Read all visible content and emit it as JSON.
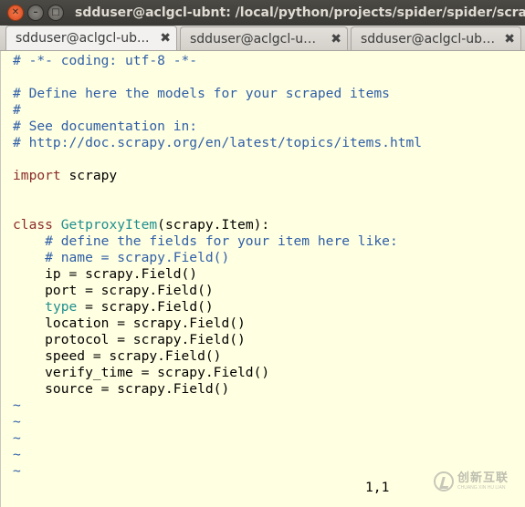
{
  "window": {
    "title": "sdduser@aclgcl-ubnt: /local/python/projects/spider/spider/scrap"
  },
  "tabs": [
    {
      "label": "sdduser@aclgcl-ub..."
    },
    {
      "label": "sdduser@aclgcl-ubn..."
    },
    {
      "label": "sdduser@aclgcl-ubn..."
    }
  ],
  "editor": {
    "l1": "# -*- coding: utf-8 -*-",
    "l3": "# Define here the models for your scraped items",
    "l4": "#",
    "l5": "# See documentation in:",
    "l6": "# http://doc.scrapy.org/en/latest/topics/items.html",
    "l8_kw": "import",
    "l8_rest": " scrapy",
    "l11_kw": "class",
    "l11_cls": " GetproxyItem",
    "l11_rest": "(scrapy.Item):",
    "l12": "    # define the fields for your item here like:",
    "l13": "    # name = scrapy.Field()",
    "l14": "    ip = scrapy.Field()",
    "l15": "    port = scrapy.Field()",
    "l16_indent": "    ",
    "l16_bi": "type",
    "l16_rest": " = scrapy.Field()",
    "l17": "    location = scrapy.Field()",
    "l18": "    protocol = scrapy.Field()",
    "l19": "    speed = scrapy.Field()",
    "l20": "    verify_time = scrapy.Field()",
    "l21": "    source = scrapy.Field()",
    "tilde": "~",
    "cursor_pos": "1,1"
  },
  "watermark": {
    "main": "创新互联",
    "sub": "CHUANG XIN HU LIAN"
  }
}
